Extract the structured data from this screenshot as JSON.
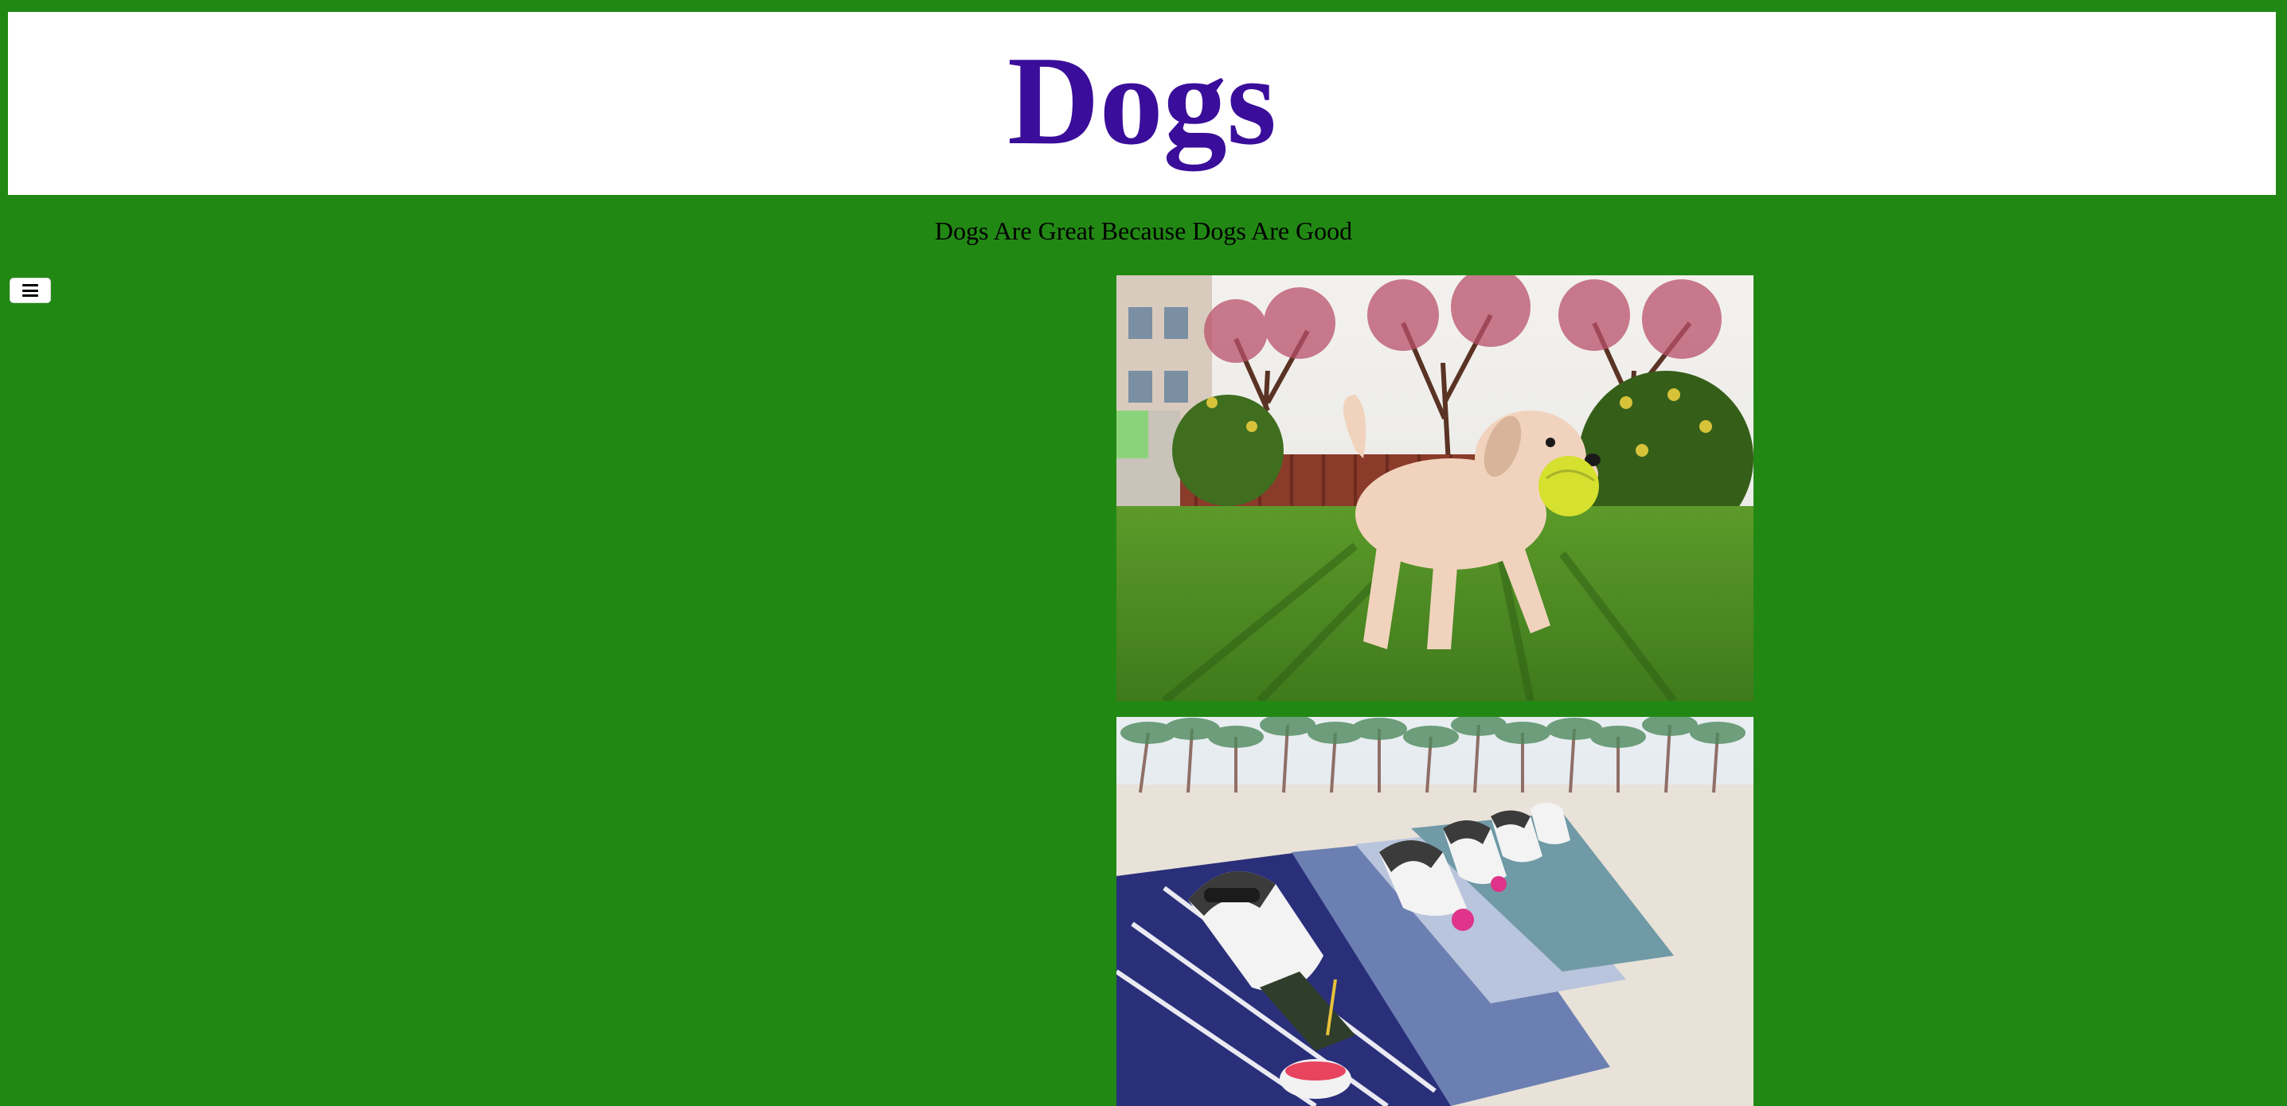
{
  "header": {
    "title": "Dogs"
  },
  "tagline": "Dogs Are Great Because Dogs Are Good",
  "menu": {
    "icon": "hamburger-menu-icon"
  },
  "gallery": [
    {
      "subject": "dog-running-with-ball-photo"
    },
    {
      "subject": "huskies-on-beach-loungers-photo"
    }
  ],
  "colors": {
    "background": "#228814",
    "header_bg": "#ffffff",
    "title": "#3a0e9a",
    "tagline": "#000000"
  }
}
